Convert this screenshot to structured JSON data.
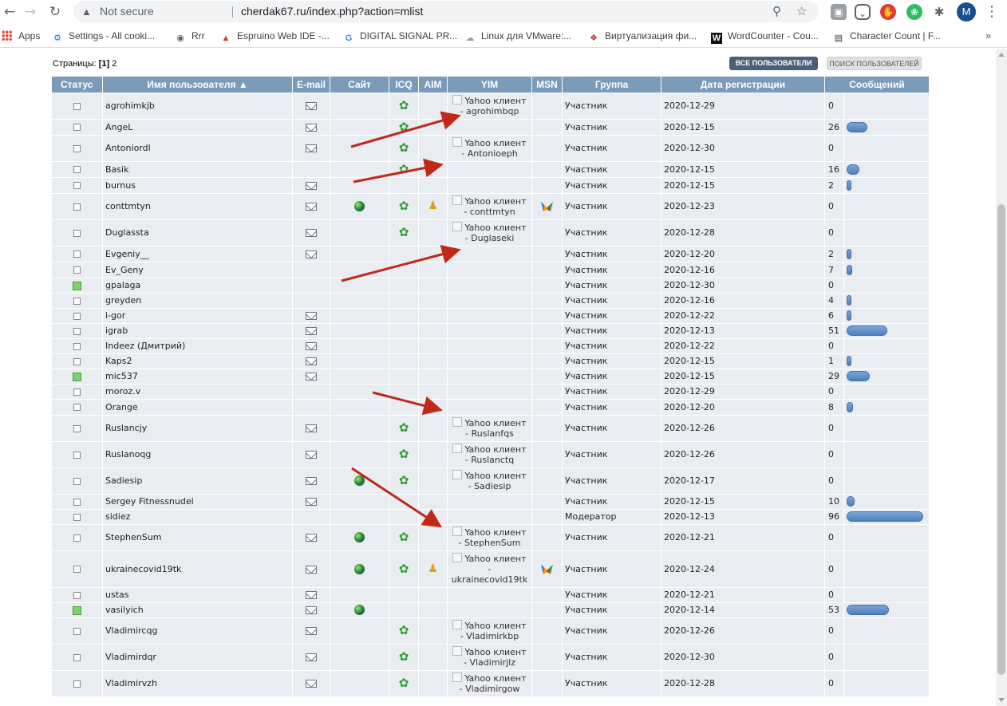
{
  "browser": {
    "security": "Not secure",
    "url": "cherdak67.ru/index.php?action=mlist",
    "profile_initial": "M",
    "bookmarks": [
      {
        "label": "Apps",
        "icon": "apps-grid-icon"
      },
      {
        "label": "Settings - All cooki...",
        "icon": "gear-icon"
      },
      {
        "label": "Rrr",
        "icon": "globe-icon"
      },
      {
        "label": "Espruino Web IDE -...",
        "icon": "espruino-icon"
      },
      {
        "label": "DIGITAL SIGNAL PR...",
        "icon": "google-icon"
      },
      {
        "label": "Linux для VMware:...",
        "icon": "cloud-icon"
      },
      {
        "label": "Виртуализация фи...",
        "icon": "red-logo-icon"
      },
      {
        "label": "WordCounter - Cou...",
        "icon": "w-logo-icon"
      },
      {
        "label": "Character Count | F...",
        "icon": "chart-icon"
      }
    ]
  },
  "pagination": {
    "label": "Страницы:",
    "current": "[1]",
    "other": "2"
  },
  "buttons": {
    "all_users": "ВСЕ ПОЛЬЗОВАТЕЛИ",
    "search_users": "ПОИСК ПОЛЬЗОВАТЕЛЕЙ"
  },
  "columns": {
    "status": "Статус",
    "username": "Имя пользователя",
    "email": "E-mail",
    "site": "Сайт",
    "icq": "ICQ",
    "aim": "AIM",
    "yim": "YIM",
    "msn": "MSN",
    "group": "Группа",
    "registered": "Дата регистрации",
    "posts": "Сообщений"
  },
  "yim_prefix": "Yahoo клиент",
  "accent": {
    "header": "#7c9ab9",
    "row": "#e9ecf1",
    "bar": "#5a86c4",
    "arrow": "#c0291a"
  },
  "max_posts": 96,
  "users": [
    {
      "name": "agrohimkjb",
      "online": false,
      "email": true,
      "site": false,
      "icq": true,
      "aim": false,
      "msn": false,
      "yim": "agrohimbqp",
      "group": "Участник",
      "date": "2020-12-29",
      "posts": 0
    },
    {
      "name": "AngeL",
      "online": false,
      "email": true,
      "site": false,
      "icq": true,
      "aim": false,
      "msn": false,
      "yim": "",
      "group": "Участник",
      "date": "2020-12-15",
      "posts": 26
    },
    {
      "name": "Antoniordl",
      "online": false,
      "email": true,
      "site": false,
      "icq": true,
      "aim": false,
      "msn": false,
      "yim": "Antonioeph",
      "group": "Участник",
      "date": "2020-12-30",
      "posts": 0
    },
    {
      "name": "Basik",
      "online": false,
      "email": false,
      "site": false,
      "icq": true,
      "aim": false,
      "msn": false,
      "yim": "",
      "group": "Участник",
      "date": "2020-12-15",
      "posts": 16
    },
    {
      "name": "burnus",
      "online": false,
      "email": true,
      "site": false,
      "icq": false,
      "aim": false,
      "msn": false,
      "yim": "",
      "group": "Участник",
      "date": "2020-12-15",
      "posts": 2
    },
    {
      "name": "conttmtyn",
      "online": false,
      "email": true,
      "site": true,
      "icq": true,
      "aim": true,
      "msn": true,
      "yim": "conttmtyn",
      "group": "Участник",
      "date": "2020-12-23",
      "posts": 0
    },
    {
      "name": "Duglassta",
      "online": false,
      "email": true,
      "site": false,
      "icq": true,
      "aim": false,
      "msn": false,
      "yim": "Duglaseki",
      "group": "Участник",
      "date": "2020-12-28",
      "posts": 0
    },
    {
      "name": "Evgeniy__",
      "online": false,
      "email": true,
      "site": false,
      "icq": false,
      "aim": false,
      "msn": false,
      "yim": "",
      "group": "Участник",
      "date": "2020-12-20",
      "posts": 2
    },
    {
      "name": "Ev_Geny",
      "online": false,
      "email": false,
      "site": false,
      "icq": false,
      "aim": false,
      "msn": false,
      "yim": "",
      "group": "Участник",
      "date": "2020-12-16",
      "posts": 7
    },
    {
      "name": "gpalaga",
      "online": true,
      "email": false,
      "site": false,
      "icq": false,
      "aim": false,
      "msn": false,
      "yim": "",
      "group": "Участник",
      "date": "2020-12-30",
      "posts": 0
    },
    {
      "name": "greyden",
      "online": false,
      "email": false,
      "site": false,
      "icq": false,
      "aim": false,
      "msn": false,
      "yim": "",
      "group": "Участник",
      "date": "2020-12-16",
      "posts": 4
    },
    {
      "name": "i-gor",
      "online": false,
      "email": true,
      "site": false,
      "icq": false,
      "aim": false,
      "msn": false,
      "yim": "",
      "group": "Участник",
      "date": "2020-12-22",
      "posts": 6
    },
    {
      "name": "igrab",
      "online": false,
      "email": true,
      "site": false,
      "icq": false,
      "aim": false,
      "msn": false,
      "yim": "",
      "group": "Участник",
      "date": "2020-12-13",
      "posts": 51
    },
    {
      "name": "Indeez (Дмитрий)",
      "online": false,
      "email": true,
      "site": false,
      "icq": false,
      "aim": false,
      "msn": false,
      "yim": "",
      "group": "Участник",
      "date": "2020-12-22",
      "posts": 0
    },
    {
      "name": "Kaps2",
      "online": false,
      "email": true,
      "site": false,
      "icq": false,
      "aim": false,
      "msn": false,
      "yim": "",
      "group": "Участник",
      "date": "2020-12-15",
      "posts": 1
    },
    {
      "name": "mic537",
      "online": true,
      "email": true,
      "site": false,
      "icq": false,
      "aim": false,
      "msn": false,
      "yim": "",
      "group": "Участник",
      "date": "2020-12-15",
      "posts": 29
    },
    {
      "name": "moroz.v",
      "online": false,
      "email": false,
      "site": false,
      "icq": false,
      "aim": false,
      "msn": false,
      "yim": "",
      "group": "Участник",
      "date": "2020-12-29",
      "posts": 0
    },
    {
      "name": "Orange",
      "online": false,
      "email": false,
      "site": false,
      "icq": false,
      "aim": false,
      "msn": false,
      "yim": "",
      "group": "Участник",
      "date": "2020-12-20",
      "posts": 8
    },
    {
      "name": "Ruslancjy",
      "online": false,
      "email": true,
      "site": false,
      "icq": true,
      "aim": false,
      "msn": false,
      "yim": "Ruslanfqs",
      "group": "Участник",
      "date": "2020-12-26",
      "posts": 0
    },
    {
      "name": "Ruslanoqg",
      "online": false,
      "email": true,
      "site": false,
      "icq": true,
      "aim": false,
      "msn": false,
      "yim": "Ruslanctq",
      "group": "Участник",
      "date": "2020-12-26",
      "posts": 0
    },
    {
      "name": "Sadiesip",
      "online": false,
      "email": true,
      "site": true,
      "icq": true,
      "aim": false,
      "msn": false,
      "yim": "Sadiesip",
      "group": "Участник",
      "date": "2020-12-17",
      "posts": 0
    },
    {
      "name": "Sergey Fitnessnudel",
      "online": false,
      "email": true,
      "site": false,
      "icq": false,
      "aim": false,
      "msn": false,
      "yim": "",
      "group": "Участник",
      "date": "2020-12-15",
      "posts": 10
    },
    {
      "name": "sidiez",
      "online": false,
      "email": false,
      "site": false,
      "icq": false,
      "aim": false,
      "msn": false,
      "yim": "",
      "group": "Модератор",
      "date": "2020-12-13",
      "posts": 96
    },
    {
      "name": "StephenSum",
      "online": false,
      "email": true,
      "site": true,
      "icq": true,
      "aim": false,
      "msn": false,
      "yim": "StephenSum",
      "group": "Участник",
      "date": "2020-12-21",
      "posts": 0
    },
    {
      "name": "ukrainecovid19tk",
      "online": false,
      "email": true,
      "site": true,
      "icq": true,
      "aim": true,
      "msn": true,
      "yim": "ukrainecovid19tk",
      "group": "Участник",
      "date": "2020-12-24",
      "posts": 0
    },
    {
      "name": "ustas",
      "online": false,
      "email": true,
      "site": false,
      "icq": false,
      "aim": false,
      "msn": false,
      "yim": "",
      "group": "Участник",
      "date": "2020-12-21",
      "posts": 0
    },
    {
      "name": "vasilyich",
      "online": true,
      "email": true,
      "site": true,
      "icq": false,
      "aim": false,
      "msn": false,
      "yim": "",
      "group": "Участник",
      "date": "2020-12-14",
      "posts": 53
    },
    {
      "name": "Vladimircqg",
      "online": false,
      "email": true,
      "site": false,
      "icq": true,
      "aim": false,
      "msn": false,
      "yim": "Vladimirkbp",
      "group": "Участник",
      "date": "2020-12-26",
      "posts": 0
    },
    {
      "name": "Vladimirdqr",
      "online": false,
      "email": true,
      "site": false,
      "icq": true,
      "aim": false,
      "msn": false,
      "yim": "Vladimirjlz",
      "group": "Участник",
      "date": "2020-12-30",
      "posts": 0
    },
    {
      "name": "Vladimirvzh",
      "online": false,
      "email": true,
      "site": false,
      "icq": true,
      "aim": false,
      "msn": false,
      "yim": "Vladimirgow",
      "group": "Участник",
      "date": "2020-12-28",
      "posts": 0
    }
  ]
}
